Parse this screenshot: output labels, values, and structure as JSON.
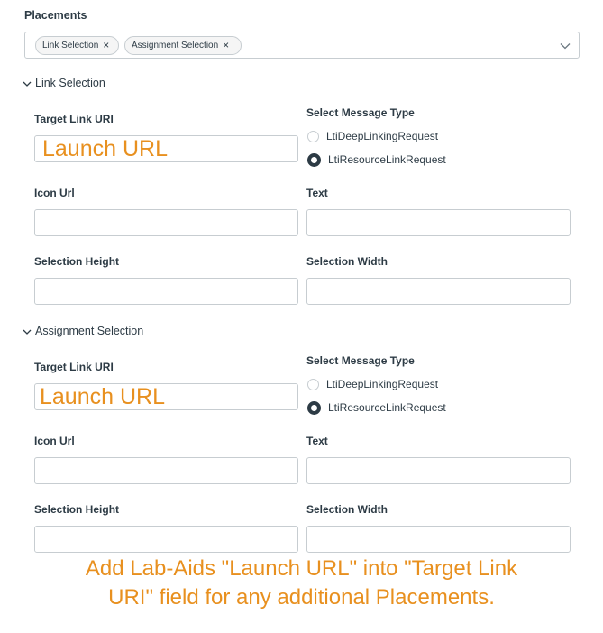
{
  "placements": {
    "label": "Placements",
    "tags": [
      {
        "label": "Link Selection",
        "remove_icon": "×"
      },
      {
        "label": "Assignment Selection",
        "remove_icon": "×"
      }
    ]
  },
  "sections": [
    {
      "title": "Link Selection",
      "target_link_uri": {
        "label": "Target Link URI",
        "value": "Launch URL"
      },
      "message_type": {
        "label": "Select Message Type",
        "options": [
          "LtiDeepLinkingRequest",
          "LtiResourceLinkRequest"
        ],
        "selected": "LtiResourceLinkRequest"
      },
      "icon_url": {
        "label": "Icon Url",
        "value": ""
      },
      "text": {
        "label": "Text",
        "value": ""
      },
      "selection_height": {
        "label": "Selection Height",
        "value": ""
      },
      "selection_width": {
        "label": "Selection Width",
        "value": ""
      }
    },
    {
      "title": "Assignment Selection",
      "target_link_uri": {
        "label": "Target Link URI",
        "value": "Launch URL"
      },
      "message_type": {
        "label": "Select Message Type",
        "options": [
          "LtiDeepLinkingRequest",
          "LtiResourceLinkRequest"
        ],
        "selected": "LtiResourceLinkRequest"
      },
      "icon_url": {
        "label": "Icon Url",
        "value": ""
      },
      "text": {
        "label": "Text",
        "value": ""
      },
      "selection_height": {
        "label": "Selection Height",
        "value": ""
      },
      "selection_width": {
        "label": "Selection Width",
        "value": ""
      }
    }
  ],
  "annotation": {
    "line1": "Add Lab-Aids \"Launch URL\" into \"Target Link",
    "line2": "URI\" field for any additional Placements.",
    "color": "#e8901f"
  }
}
